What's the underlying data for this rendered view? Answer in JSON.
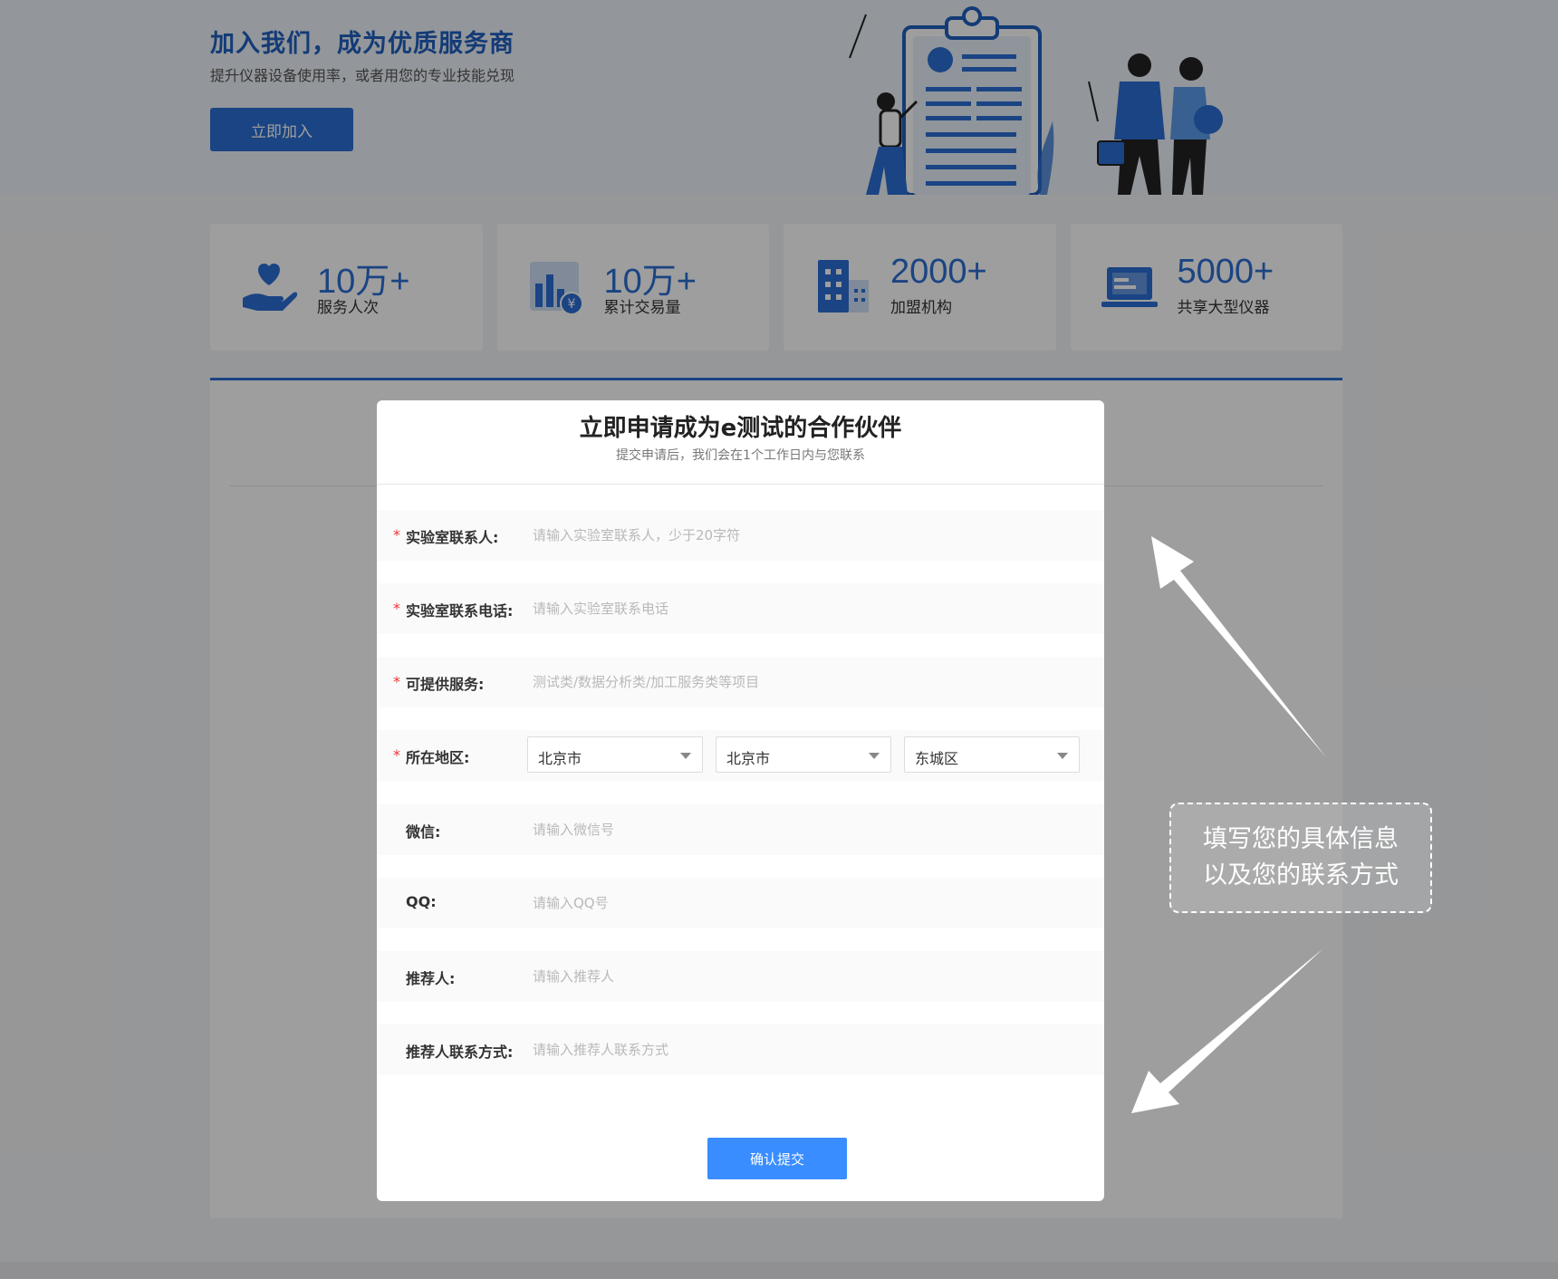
{
  "hero": {
    "title": "加入我们，成为优质服务商",
    "subtitle": "提升仪器设备使用率，或者用您的专业技能兑现",
    "join_button": "立即加入"
  },
  "stats": [
    {
      "value": "10万+",
      "label": "服务人次",
      "icon": "hand-heart-icon"
    },
    {
      "value": "10万+",
      "label": "累计交易量",
      "icon": "bar-chart-yuan-icon"
    },
    {
      "value": "2000+",
      "label": "加盟机构",
      "icon": "buildings-icon"
    },
    {
      "value": "5000+",
      "label": "共享大型仪器",
      "icon": "laptop-icon"
    }
  ],
  "modal": {
    "title": "立即申请成为e测试的合作伙伴",
    "subtitle": "提交申请后，我们会在1个工作日内与您联系",
    "required_mark": "*",
    "fields": {
      "contact": {
        "label": "实验室联系人:",
        "placeholder": "请输入实验室联系人，少于20字符"
      },
      "phone": {
        "label": "实验室联系电话:",
        "placeholder": "请输入实验室联系电话"
      },
      "services": {
        "label": "可提供服务:",
        "placeholder": "测试类/数据分析类/加工服务类等项目"
      },
      "region": {
        "label": "所在地区:",
        "province": "北京市",
        "city": "北京市",
        "district": "东城区"
      },
      "wechat": {
        "label": "微信:",
        "placeholder": "请输入微信号"
      },
      "qq": {
        "label": "QQ:",
        "placeholder": "请输入QQ号"
      },
      "referrer": {
        "label": "推荐人:",
        "placeholder": "请输入推荐人"
      },
      "referrer_contact": {
        "label": "推荐人联系方式:",
        "placeholder": "请输入推荐人联系方式"
      }
    },
    "submit_button": "确认提交"
  },
  "callout": {
    "line1": "填写您的具体信息",
    "line2": "以及您的联系方式"
  },
  "colors": {
    "primary": "#2b6fd3",
    "submit": "#3a8dff",
    "required": "#e33333"
  }
}
